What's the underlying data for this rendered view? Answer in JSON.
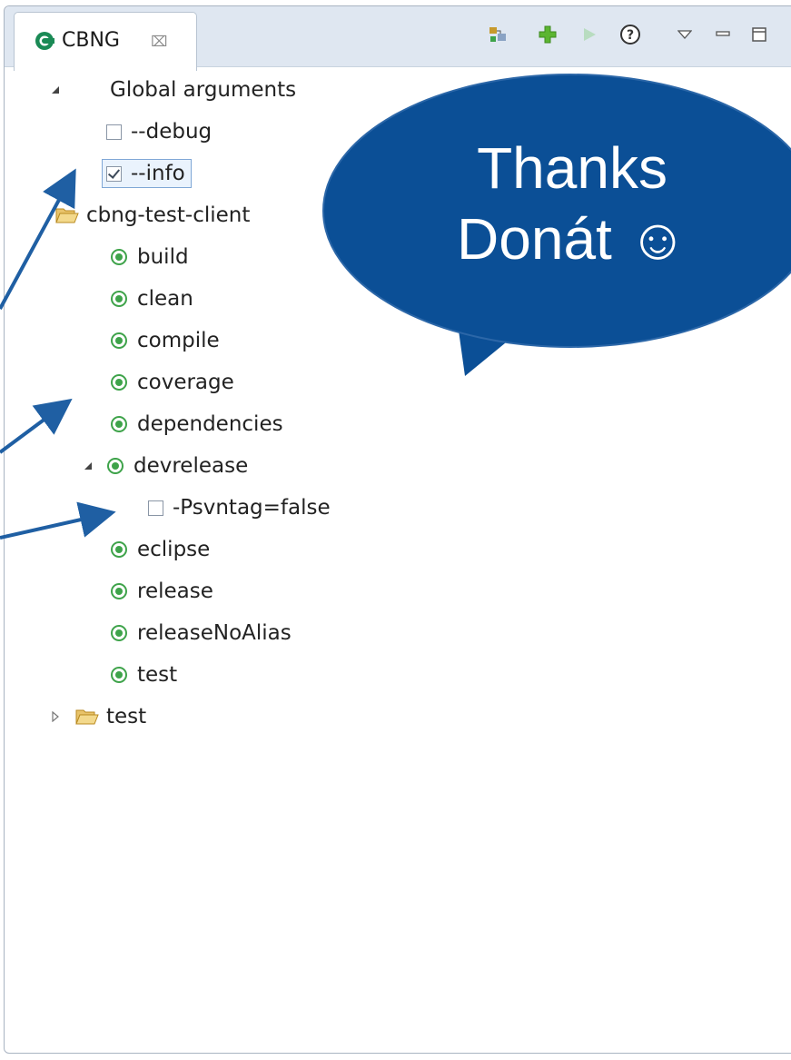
{
  "view": {
    "title": "CBNG",
    "close_glyph": "⌧",
    "toolbar": [
      "add-project-icon",
      "add-argument-icon",
      "run-icon",
      "help-icon",
      "view-menu-icon",
      "minimize-icon",
      "maximize-icon"
    ]
  },
  "tree": {
    "global_arguments": {
      "label": "Global arguments",
      "items": [
        {
          "label": "--debug",
          "checked": false
        },
        {
          "label": "--info",
          "checked": true
        }
      ]
    },
    "project": {
      "label": "cbng-test-client",
      "tasks": [
        {
          "label": "build"
        },
        {
          "label": "clean"
        },
        {
          "label": "compile"
        },
        {
          "label": "coverage"
        },
        {
          "label": "dependencies"
        },
        {
          "label": "devrelease",
          "expanded": true,
          "args": [
            {
              "label": "-Psvntag=false",
              "checked": false
            }
          ]
        },
        {
          "label": "eclipse"
        },
        {
          "label": "release"
        },
        {
          "label": "releaseNoAlias"
        },
        {
          "label": "test"
        }
      ]
    },
    "project2": {
      "label": "test"
    }
  },
  "callout": {
    "line1": "Thanks",
    "line2": "Donát ☺",
    "color": "#0b4f96"
  },
  "colors": {
    "arrow": "#1f5fa3",
    "task_green": "#3ea34a"
  }
}
